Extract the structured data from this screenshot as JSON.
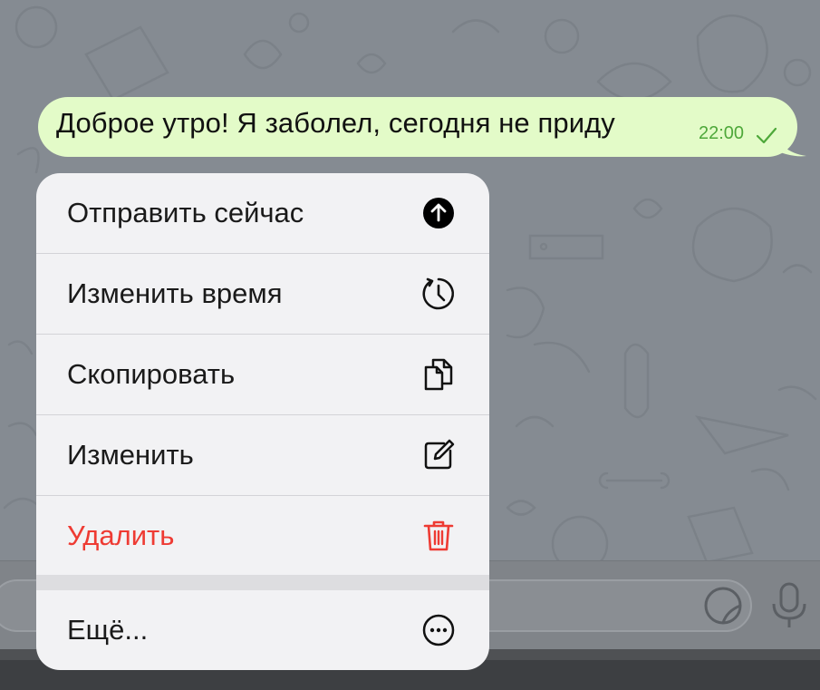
{
  "message": {
    "text": "Доброе утро! Я заболел, сегодня не приду",
    "time": "22:00",
    "status_icon": "check-icon"
  },
  "context_menu": {
    "items": [
      {
        "label": "Отправить сейчас",
        "icon": "send-now-icon",
        "danger": false
      },
      {
        "label": "Изменить время",
        "icon": "reschedule-clock-icon",
        "danger": false
      },
      {
        "label": "Скопировать",
        "icon": "copy-icon",
        "danger": false
      },
      {
        "label": "Изменить",
        "icon": "edit-icon",
        "danger": false
      },
      {
        "label": "Удалить",
        "icon": "trash-icon",
        "danger": true
      }
    ],
    "more": {
      "label": "Ещё...",
      "icon": "more-icon"
    }
  },
  "input_bar": {
    "sticker_icon": "sticker-icon",
    "mic_icon": "microphone-icon"
  },
  "colors": {
    "bubble": "#e3fbc8",
    "time": "#4ea83a",
    "danger": "#ee3b33",
    "menu_bg": "#f2f2f4",
    "wallpaper": "#858b92"
  }
}
